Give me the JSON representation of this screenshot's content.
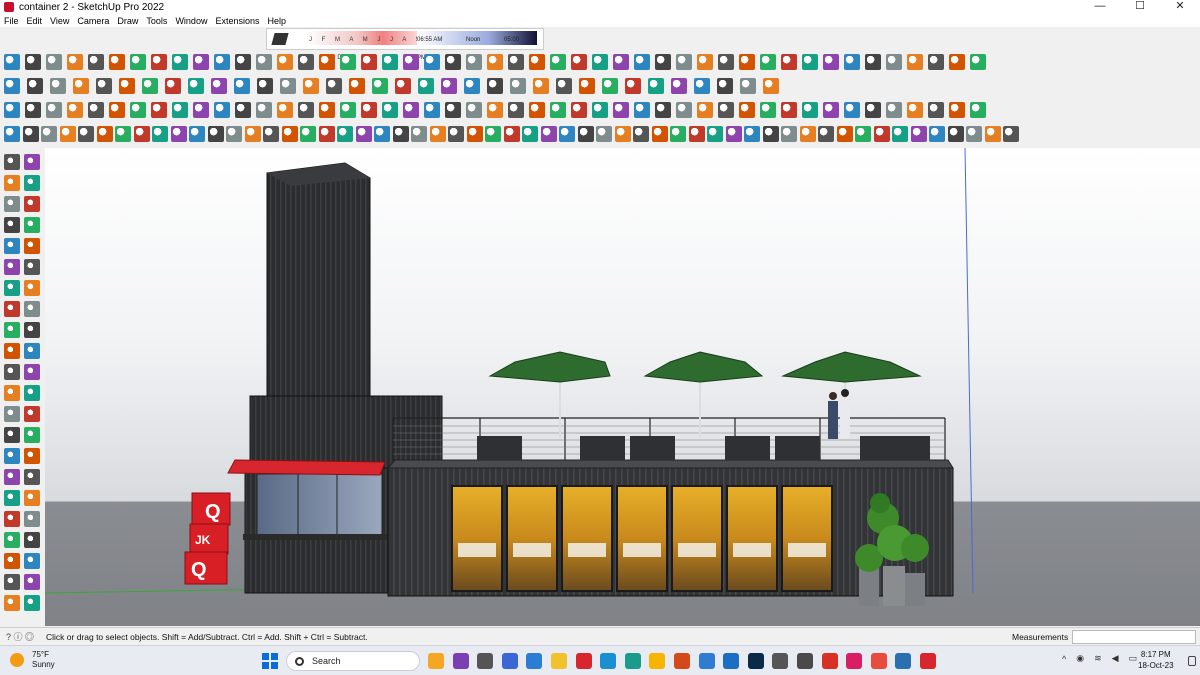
{
  "window": {
    "title": "container 2 - SketchUp Pro 2022",
    "controls": [
      "—",
      "☐",
      "✕"
    ]
  },
  "menu": [
    "File",
    "Edit",
    "View",
    "Camera",
    "Draw",
    "Tools",
    "Window",
    "Extensions",
    "Help"
  ],
  "shadow_settings": {
    "months": "J F M A M J J A S O N D",
    "time_start": "06:55 AM",
    "time_noon": "Noon",
    "time_end": "05:00 PM"
  },
  "model": {
    "signs": [
      "Q",
      "JK",
      "Q",
      "Q",
      "JK",
      "Q"
    ],
    "window_text": [
      "Petite",
      "Petite"
    ]
  },
  "status": {
    "hint": "Click or drag to select objects. Shift = Add/Subtract. Ctrl = Add. Shift + Ctrl = Subtract.",
    "measurements_label": "Measurements",
    "icons": "? ⓘ ◎"
  },
  "taskbar": {
    "weather_temp": "75°F",
    "weather_cond": "Sunny",
    "search_placeholder": "Search",
    "time": "8:17 PM",
    "date": "18-Oct-23",
    "tray_chevron": "^"
  },
  "colors": {
    "accent": "#c8102e",
    "umbrella": "#2e6b2f",
    "container": "#2b2c2e",
    "sky": "#f2f3f5",
    "ground": "#84878c"
  }
}
